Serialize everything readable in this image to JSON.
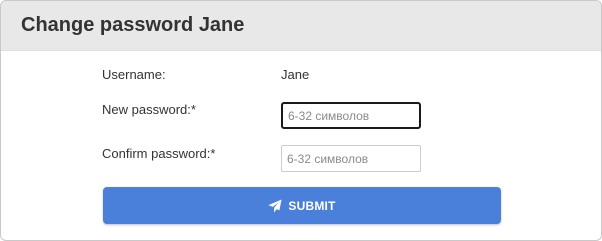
{
  "dialog": {
    "title": "Change password Jane"
  },
  "form": {
    "username_label": "Username:",
    "username_value": "Jane",
    "new_password_label": "New password:*",
    "new_password_placeholder": "6-32 символов",
    "new_password_value": "",
    "confirm_password_label": "Confirm password:*",
    "confirm_password_placeholder": "6-32 символов",
    "confirm_password_value": ""
  },
  "actions": {
    "submit_label": "SUBMIT",
    "submit_icon": "paper-plane-icon"
  },
  "colors": {
    "header_bg": "#e8e8e8",
    "submit_bg": "#4a80d9"
  }
}
